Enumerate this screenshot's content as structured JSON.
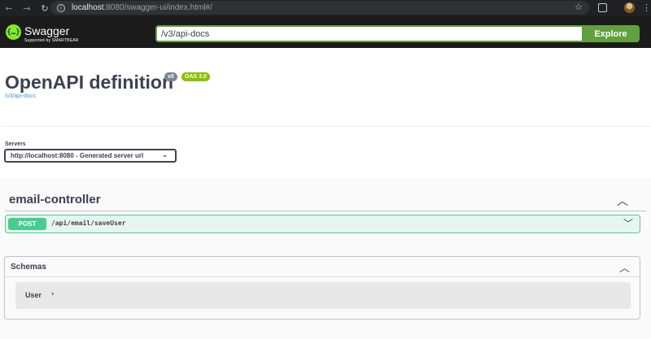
{
  "browser": {
    "url_host": "localhost",
    "url_rest": ":8080/swagger-ui/index.html#/"
  },
  "topbar": {
    "brand": "Swagger",
    "brand_sub": "Supported by SMARTBEAR",
    "spec_url_value": "/v3/api-docs",
    "explore_label": "Explore"
  },
  "info": {
    "title": "OpenAPI definition",
    "version_badge": "v0",
    "oas_badge": "OAS 3.0",
    "spec_link": "/v3/api-docs"
  },
  "servers": {
    "label": "Servers",
    "selected": "http://localhost:8080 - Generated server url"
  },
  "tags": [
    {
      "name": "email-controller",
      "operations": [
        {
          "method": "POST",
          "path": "/api/email/saveUser"
        }
      ]
    }
  ],
  "schemas": {
    "title": "Schemas",
    "models": [
      {
        "name": "User"
      }
    ]
  },
  "colors": {
    "post": "#49cc90",
    "accent": "#62a03f",
    "oas_badge": "#89bf04"
  }
}
